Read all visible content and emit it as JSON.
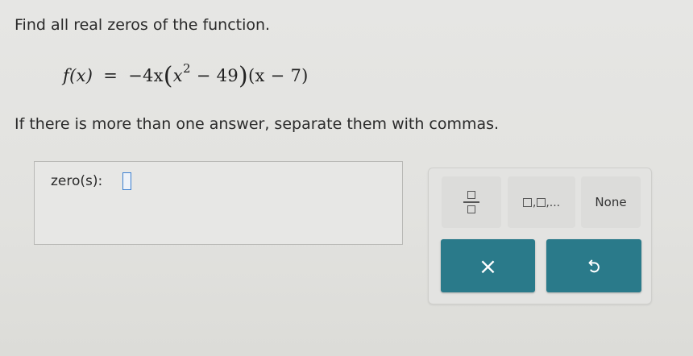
{
  "question": {
    "instruction": "Find all real zeros of the function.",
    "equation": {
      "lhs": "f(x)",
      "equals": "=",
      "coefficient": "−4x",
      "factor1_inner": "x",
      "factor1_exponent": "2",
      "factor1_tail": "− 49",
      "factor2": "(x − 7)"
    },
    "note": "If there is more than one answer, separate them with commas."
  },
  "answer": {
    "label": "zero(s):",
    "value": ""
  },
  "keypad": {
    "keys": [
      {
        "name": "fraction",
        "icon": "fraction-icon"
      },
      {
        "name": "list",
        "icon": "list-icon",
        "suffix": ",..."
      },
      {
        "name": "none",
        "label": "None"
      }
    ],
    "actions": {
      "clear_icon": "×",
      "undo_icon": "undo-icon",
      "color": "#2a7a8a"
    }
  }
}
